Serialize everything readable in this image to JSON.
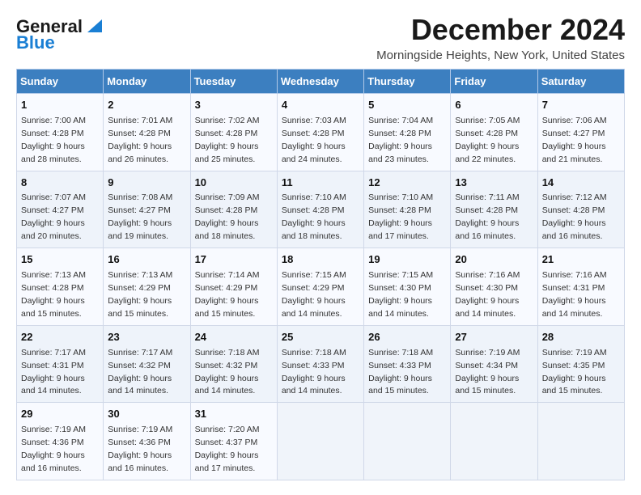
{
  "logo": {
    "line1": "General",
    "line2": "Blue"
  },
  "title": "December 2024",
  "subtitle": "Morningside Heights, New York, United States",
  "days_of_week": [
    "Sunday",
    "Monday",
    "Tuesday",
    "Wednesday",
    "Thursday",
    "Friday",
    "Saturday"
  ],
  "weeks": [
    [
      {
        "day": 1,
        "sunrise": "7:00 AM",
        "sunset": "4:28 PM",
        "daylight": "9 hours and 28 minutes."
      },
      {
        "day": 2,
        "sunrise": "7:01 AM",
        "sunset": "4:28 PM",
        "daylight": "9 hours and 26 minutes."
      },
      {
        "day": 3,
        "sunrise": "7:02 AM",
        "sunset": "4:28 PM",
        "daylight": "9 hours and 25 minutes."
      },
      {
        "day": 4,
        "sunrise": "7:03 AM",
        "sunset": "4:28 PM",
        "daylight": "9 hours and 24 minutes."
      },
      {
        "day": 5,
        "sunrise": "7:04 AM",
        "sunset": "4:28 PM",
        "daylight": "9 hours and 23 minutes."
      },
      {
        "day": 6,
        "sunrise": "7:05 AM",
        "sunset": "4:28 PM",
        "daylight": "9 hours and 22 minutes."
      },
      {
        "day": 7,
        "sunrise": "7:06 AM",
        "sunset": "4:27 PM",
        "daylight": "9 hours and 21 minutes."
      }
    ],
    [
      {
        "day": 8,
        "sunrise": "7:07 AM",
        "sunset": "4:27 PM",
        "daylight": "9 hours and 20 minutes."
      },
      {
        "day": 9,
        "sunrise": "7:08 AM",
        "sunset": "4:27 PM",
        "daylight": "9 hours and 19 minutes."
      },
      {
        "day": 10,
        "sunrise": "7:09 AM",
        "sunset": "4:28 PM",
        "daylight": "9 hours and 18 minutes."
      },
      {
        "day": 11,
        "sunrise": "7:10 AM",
        "sunset": "4:28 PM",
        "daylight": "9 hours and 18 minutes."
      },
      {
        "day": 12,
        "sunrise": "7:10 AM",
        "sunset": "4:28 PM",
        "daylight": "9 hours and 17 minutes."
      },
      {
        "day": 13,
        "sunrise": "7:11 AM",
        "sunset": "4:28 PM",
        "daylight": "9 hours and 16 minutes."
      },
      {
        "day": 14,
        "sunrise": "7:12 AM",
        "sunset": "4:28 PM",
        "daylight": "9 hours and 16 minutes."
      }
    ],
    [
      {
        "day": 15,
        "sunrise": "7:13 AM",
        "sunset": "4:28 PM",
        "daylight": "9 hours and 15 minutes."
      },
      {
        "day": 16,
        "sunrise": "7:13 AM",
        "sunset": "4:29 PM",
        "daylight": "9 hours and 15 minutes."
      },
      {
        "day": 17,
        "sunrise": "7:14 AM",
        "sunset": "4:29 PM",
        "daylight": "9 hours and 15 minutes."
      },
      {
        "day": 18,
        "sunrise": "7:15 AM",
        "sunset": "4:29 PM",
        "daylight": "9 hours and 14 minutes."
      },
      {
        "day": 19,
        "sunrise": "7:15 AM",
        "sunset": "4:30 PM",
        "daylight": "9 hours and 14 minutes."
      },
      {
        "day": 20,
        "sunrise": "7:16 AM",
        "sunset": "4:30 PM",
        "daylight": "9 hours and 14 minutes."
      },
      {
        "day": 21,
        "sunrise": "7:16 AM",
        "sunset": "4:31 PM",
        "daylight": "9 hours and 14 minutes."
      }
    ],
    [
      {
        "day": 22,
        "sunrise": "7:17 AM",
        "sunset": "4:31 PM",
        "daylight": "9 hours and 14 minutes."
      },
      {
        "day": 23,
        "sunrise": "7:17 AM",
        "sunset": "4:32 PM",
        "daylight": "9 hours and 14 minutes."
      },
      {
        "day": 24,
        "sunrise": "7:18 AM",
        "sunset": "4:32 PM",
        "daylight": "9 hours and 14 minutes."
      },
      {
        "day": 25,
        "sunrise": "7:18 AM",
        "sunset": "4:33 PM",
        "daylight": "9 hours and 14 minutes."
      },
      {
        "day": 26,
        "sunrise": "7:18 AM",
        "sunset": "4:33 PM",
        "daylight": "9 hours and 15 minutes."
      },
      {
        "day": 27,
        "sunrise": "7:19 AM",
        "sunset": "4:34 PM",
        "daylight": "9 hours and 15 minutes."
      },
      {
        "day": 28,
        "sunrise": "7:19 AM",
        "sunset": "4:35 PM",
        "daylight": "9 hours and 15 minutes."
      }
    ],
    [
      {
        "day": 29,
        "sunrise": "7:19 AM",
        "sunset": "4:36 PM",
        "daylight": "9 hours and 16 minutes."
      },
      {
        "day": 30,
        "sunrise": "7:19 AM",
        "sunset": "4:36 PM",
        "daylight": "9 hours and 16 minutes."
      },
      {
        "day": 31,
        "sunrise": "7:20 AM",
        "sunset": "4:37 PM",
        "daylight": "9 hours and 17 minutes."
      },
      null,
      null,
      null,
      null
    ]
  ]
}
